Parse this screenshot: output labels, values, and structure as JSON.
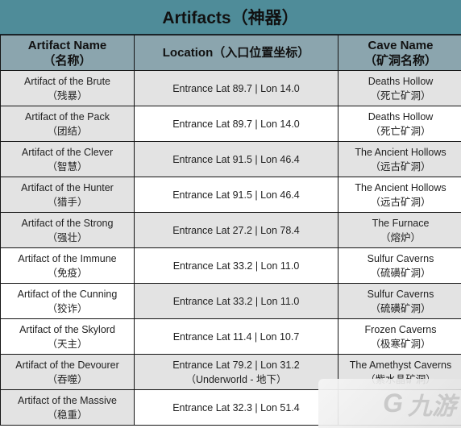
{
  "title": "Artifacts（神器）",
  "headers": {
    "name": "Artifact Name",
    "name_cn": "（名称）",
    "location": "Location（入口位置坐标）",
    "cave": "Cave Name",
    "cave_cn": "（矿洞名称）"
  },
  "rows": [
    {
      "name": "Artifact of the Brute",
      "name_cn": "（残暴）",
      "location": "Entrance Lat 89.7 | Lon 14.0",
      "location_note": "",
      "cave": "Deaths Hollow",
      "cave_cn": "（死亡矿洞）"
    },
    {
      "name": "Artifact of the Pack",
      "name_cn": "（团结）",
      "location": "Entrance Lat 89.7 | Lon 14.0",
      "location_note": "",
      "cave": "Deaths Hollow",
      "cave_cn": "（死亡矿洞）"
    },
    {
      "name": "Artifact of the Clever",
      "name_cn": "（智慧）",
      "location": "Entrance Lat 91.5 | Lon 46.4",
      "location_note": "",
      "cave": "The Ancient Hollows",
      "cave_cn": "（远古矿洞）"
    },
    {
      "name": "Artifact of the Hunter",
      "name_cn": "（猎手）",
      "location": "Entrance Lat 91.5 | Lon 46.4",
      "location_note": "",
      "cave": "The Ancient Hollows",
      "cave_cn": "（远古矿洞）"
    },
    {
      "name": "Artifact of the Strong",
      "name_cn": "（强壮）",
      "location": "Entrance Lat 27.2 | Lon 78.4",
      "location_note": "",
      "cave": "The Furnace",
      "cave_cn": "（熔炉）"
    },
    {
      "name": "Artifact of the Immune",
      "name_cn": "（免疫）",
      "location": "Entrance Lat 33.2 | Lon 11.0",
      "location_note": "",
      "cave": "Sulfur Caverns",
      "cave_cn": "（硫磺矿洞）"
    },
    {
      "name": "Artifact of the Cunning",
      "name_cn": "（狡诈）",
      "location": "Entrance Lat 33.2 | Lon 11.0",
      "location_note": "",
      "cave": "Sulfur Caverns",
      "cave_cn": "（硫磺矿洞）"
    },
    {
      "name": "Artifact of the Skylord",
      "name_cn": "（天主）",
      "location": "Entrance Lat 11.4 | Lon 10.7",
      "location_note": "",
      "cave": "Frozen Caverns",
      "cave_cn": "（极寒矿洞）"
    },
    {
      "name": "Artifact of the Devourer",
      "name_cn": "（吞噬）",
      "location": "Entrance Lat 79.2 | Lon 31.2",
      "location_note": "（Underworld - 地下）",
      "cave": "The Amethyst Caverns",
      "cave_cn": "（紫水晶矿洞）"
    },
    {
      "name": "Artifact of the Massive",
      "name_cn": "（稳重）",
      "location": "Entrance Lat 32.3 | Lon 51.4",
      "location_note": "",
      "cave": "",
      "cave_cn": ""
    }
  ],
  "watermark": {
    "logo": "G",
    "text": "九游"
  }
}
